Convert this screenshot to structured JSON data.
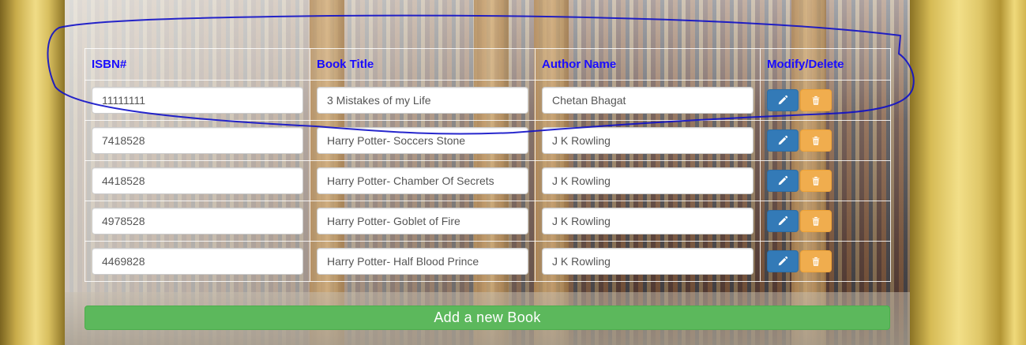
{
  "table": {
    "headers": {
      "isbn": "ISBN#",
      "title": "Book Title",
      "author": "Author Name",
      "actions": "Modify/Delete"
    },
    "rows": [
      {
        "isbn": "11111111",
        "title": "3 Mistakes of my Life",
        "author": "Chetan Bhagat"
      },
      {
        "isbn": "7418528",
        "title": "Harry Potter- Soccers Stone",
        "author": "J K Rowling"
      },
      {
        "isbn": "4418528",
        "title": "Harry Potter- Chamber Of Secrets",
        "author": "J K Rowling"
      },
      {
        "isbn": "4978528",
        "title": "Harry Potter- Goblet of Fire",
        "author": "J K Rowling"
      },
      {
        "isbn": "4469828",
        "title": "Harry Potter- Half Blood Prince",
        "author": "J K Rowling"
      }
    ],
    "edit_icon": "pencil-icon",
    "delete_icon": "trash-icon"
  },
  "add_button_label": "Add a new Book",
  "colors": {
    "header_text": "#1a0dff",
    "edit_button": "#337ab7",
    "delete_button": "#f0ad4e",
    "add_button": "#5cb85c",
    "annotation_stroke": "#1010c8"
  }
}
